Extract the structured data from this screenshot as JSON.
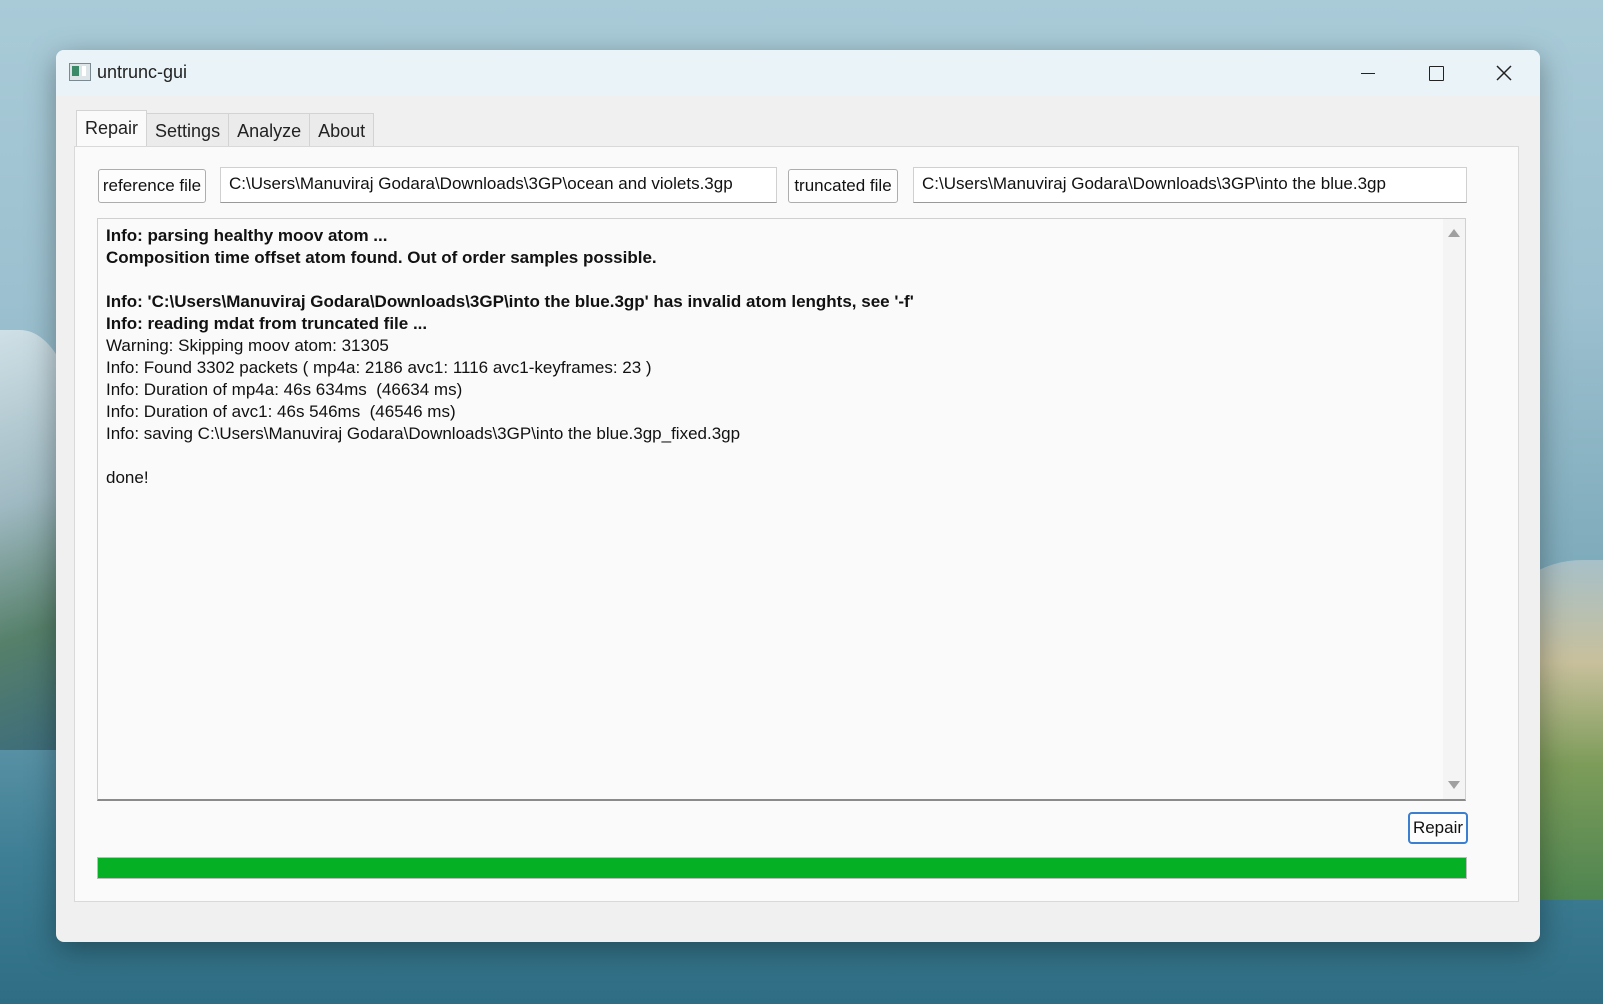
{
  "window": {
    "title": "untrunc-gui"
  },
  "tabs": [
    {
      "label": "Repair",
      "active": true
    },
    {
      "label": "Settings",
      "active": false
    },
    {
      "label": "Analyze",
      "active": false
    },
    {
      "label": "About",
      "active": false
    }
  ],
  "repair": {
    "reference_button": "reference file",
    "reference_path": "C:\\Users\\Manuviraj Godara\\Downloads\\3GP\\ocean and violets.3gp",
    "truncated_button": "truncated file",
    "truncated_path": "C:\\Users\\Manuviraj Godara\\Downloads\\3GP\\into the blue.3gp",
    "log": [
      {
        "text": "Info: parsing healthy moov atom ...",
        "bold": true
      },
      {
        "text": "Composition time offset atom found. Out of order samples possible.",
        "bold": true
      },
      {
        "text": "",
        "bold": false
      },
      {
        "text": "Info: 'C:\\Users\\Manuviraj Godara\\Downloads\\3GP\\into the blue.3gp' has invalid atom lenghts, see '-f'",
        "bold": true
      },
      {
        "text": "Info: reading mdat from truncated file ...",
        "bold": true
      },
      {
        "text": "Warning: Skipping moov atom: 31305",
        "bold": false
      },
      {
        "text": "Info: Found 3302 packets ( mp4a: 2186 avc1: 1116 avc1-keyframes: 23 )",
        "bold": false
      },
      {
        "text": "Info: Duration of mp4a: 46s 634ms  (46634 ms)",
        "bold": false
      },
      {
        "text": "Info: Duration of avc1: 46s 546ms  (46546 ms)",
        "bold": false
      },
      {
        "text": "Info: saving C:\\Users\\Manuviraj Godara\\Downloads\\3GP\\into the blue.3gp_fixed.3gp",
        "bold": false
      },
      {
        "text": "",
        "bold": false
      },
      {
        "text": "done!",
        "bold": false
      }
    ],
    "repair_button": "Repair",
    "progress": 1.0,
    "progress_color": "#06b025"
  }
}
